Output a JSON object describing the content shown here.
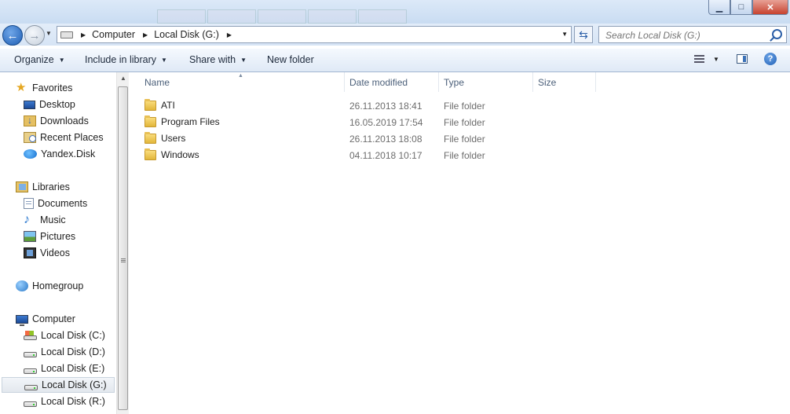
{
  "window": {
    "minimize_icon": "minimize-icon",
    "maximize_icon": "maximize-icon",
    "close_icon": "close-icon"
  },
  "address_bar": {
    "crumbs": [
      "Computer",
      "Local Disk (G:)"
    ],
    "search_placeholder": "Search Local Disk (G:)"
  },
  "toolbar": {
    "organize": "Organize",
    "include_in_library": "Include in library",
    "share_with": "Share with",
    "new_folder": "New folder"
  },
  "nav": {
    "favorites": {
      "label": "Favorites",
      "items": [
        "Desktop",
        "Downloads",
        "Recent Places",
        "Yandex.Disk"
      ]
    },
    "libraries": {
      "label": "Libraries",
      "items": [
        "Documents",
        "Music",
        "Pictures",
        "Videos"
      ]
    },
    "homegroup": "Homegroup",
    "computer": {
      "label": "Computer",
      "items": [
        "Local Disk (C:)",
        "Local Disk (D:)",
        "Local Disk (E:)",
        "Local Disk (G:)",
        "Local Disk (R:)"
      ],
      "selected": "Local Disk (G:)"
    }
  },
  "columns": {
    "name": "Name",
    "date_modified": "Date modified",
    "type": "Type",
    "size": "Size"
  },
  "files": [
    {
      "name": "ATI",
      "date": "26.11.2013 18:41",
      "type": "File folder"
    },
    {
      "name": "Program Files",
      "date": "16.05.2019 17:54",
      "type": "File folder"
    },
    {
      "name": "Users",
      "date": "26.11.2013 18:08",
      "type": "File folder"
    },
    {
      "name": "Windows",
      "date": "04.11.2018 10:17",
      "type": "File folder"
    }
  ],
  "colors": {
    "accent": "#1f5fb5",
    "toolbar_bg": "#dfe9f6",
    "secondary_text": "#6d6d6d"
  }
}
